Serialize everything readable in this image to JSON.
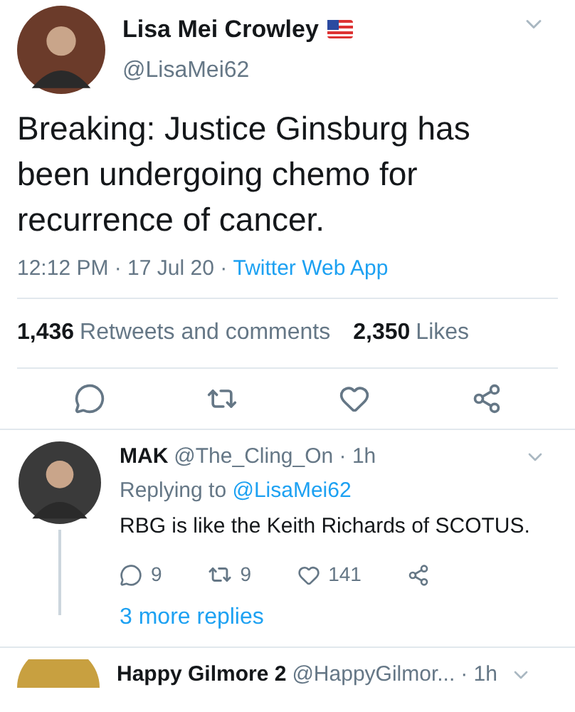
{
  "tweet": {
    "name": "Lisa Mei Crowley",
    "handle": "@LisaMei62",
    "text": "Breaking: Justice Ginsburg has been undergoing chemo for recurrence of cancer.",
    "time": "12:12 PM · 17 Jul 20 · ",
    "source": "Twitter Web App",
    "retweets": "1,436",
    "retweets_label": "Retweets and comments",
    "likes": "2,350",
    "likes_label": "Likes"
  },
  "replies": [
    {
      "name": "MAK",
      "handle": "@The_Cling_On · 1h",
      "replying_label": "Replying to ",
      "replying_to": "@LisaMei62",
      "text": "RBG is like the Keith Richards of SCOTUS.",
      "reply_count": "9",
      "retweet_count": "9",
      "like_count": "141",
      "more": "3 more replies"
    }
  ],
  "next_reply": {
    "name": "Happy Gilmore 2",
    "handle": "@HappyGilmor...",
    "time": "· 1h"
  }
}
